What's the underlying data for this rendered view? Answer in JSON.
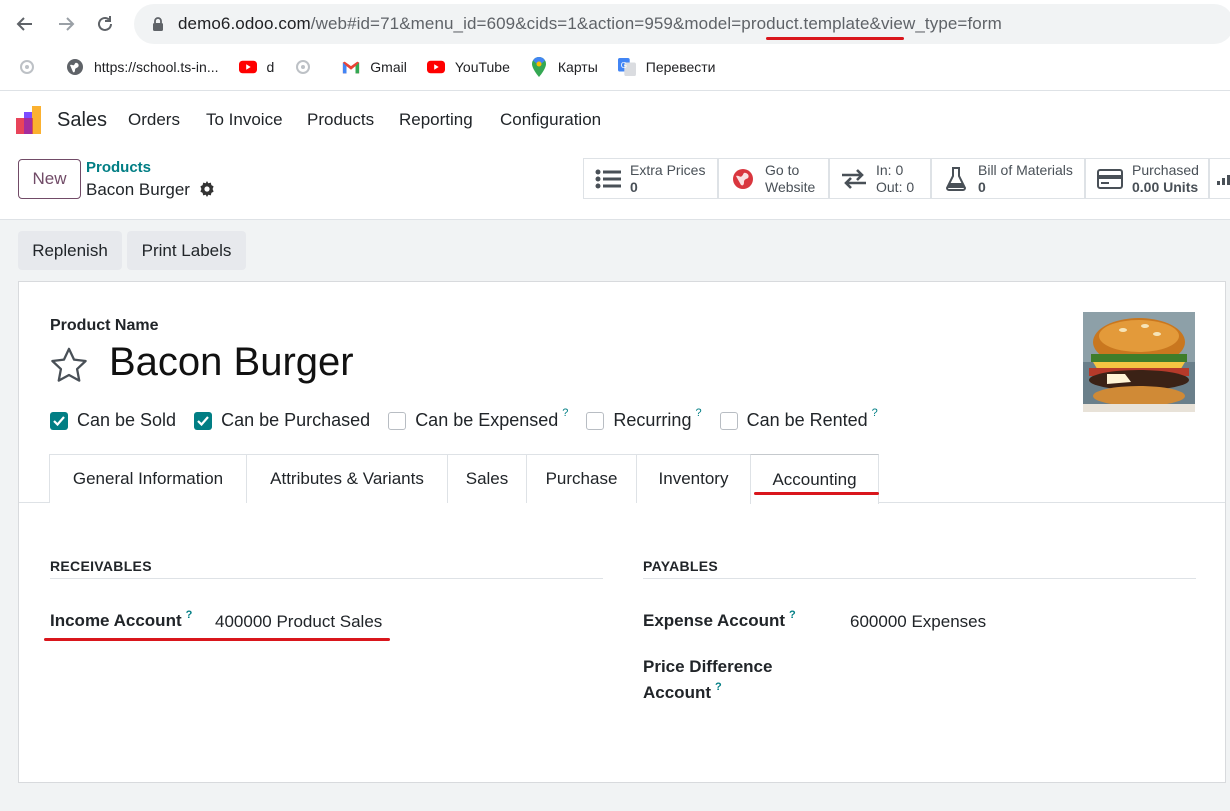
{
  "browser": {
    "url_host": "demo6.odoo.com",
    "url_path": "/web#id=71&menu_id=609&cids=1&action=959&model=",
    "url_model": "product.template",
    "url_tail": "&view_type=form",
    "bookmarks": [
      {
        "label": "https://school.ts-in...",
        "icon": "globe-icon"
      },
      {
        "label": "d",
        "icon": "youtube-icon"
      },
      {
        "label": "Gmail",
        "icon": "gmail-icon"
      },
      {
        "label": "YouTube",
        "icon": "youtube-icon"
      },
      {
        "label": "Карты",
        "icon": "maps-pin-icon"
      },
      {
        "label": "Перевести",
        "icon": "translate-icon"
      }
    ]
  },
  "navbar": {
    "app_name": "Sales",
    "menu": [
      "Orders",
      "To Invoice",
      "Products",
      "Reporting",
      "Configuration"
    ]
  },
  "control_panel": {
    "new_label": "New",
    "breadcrumb": "Products",
    "record_name": "Bacon Burger",
    "smart_buttons": [
      {
        "line1": "Extra Prices",
        "line2": "0",
        "icon": "list-icon"
      },
      {
        "line1": "Go to",
        "line2": "Website",
        "icon": "globe-icon"
      },
      {
        "line1": "In: 0",
        "line2": "Out: 0",
        "icon": "exchange-icon"
      },
      {
        "line1": "Bill of Materials",
        "line2": "0",
        "icon": "flask-icon"
      },
      {
        "line1": "Purchased",
        "line2": "0.00 Units",
        "icon": "credit-card-icon"
      }
    ]
  },
  "actions": {
    "replenish": "Replenish",
    "print_labels": "Print Labels"
  },
  "form": {
    "name_label": "Product Name",
    "product_name": "Bacon Burger",
    "checkboxes": [
      {
        "label": "Can be Sold",
        "checked": true,
        "help": false
      },
      {
        "label": "Can be Purchased",
        "checked": true,
        "help": false
      },
      {
        "label": "Can be Expensed",
        "checked": false,
        "help": true
      },
      {
        "label": "Recurring",
        "checked": false,
        "help": true
      },
      {
        "label": "Can be Rented",
        "checked": false,
        "help": true
      }
    ],
    "help_mark": "?",
    "tabs": [
      "General Information",
      "Attributes & Variants",
      "Sales",
      "Purchase",
      "Inventory",
      "Accounting"
    ],
    "active_tab": "Accounting",
    "receivables": {
      "title": "RECEIVABLES",
      "income_label": "Income Account",
      "income_value": "400000 Product Sales"
    },
    "payables": {
      "title": "PAYABLES",
      "expense_label": "Expense Account",
      "expense_value": "600000 Expenses",
      "price_diff_label_1": "Price Difference",
      "price_diff_label_2": "Account"
    }
  },
  "colors": {
    "brand": "#714b67",
    "accent": "#017e84",
    "annotation": "#d9161c"
  }
}
